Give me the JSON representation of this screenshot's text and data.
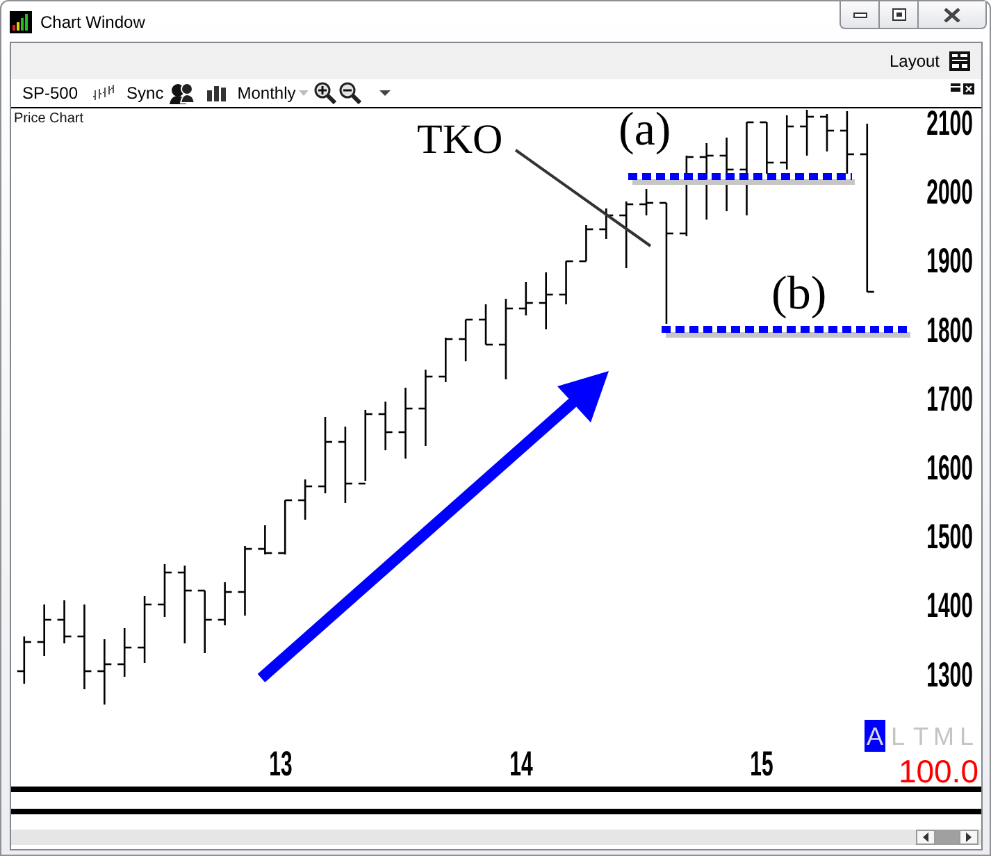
{
  "window": {
    "title": "Chart Window"
  },
  "header": {
    "layout_label": "Layout"
  },
  "toolbar": {
    "symbol": "SP-500",
    "sync_label": "Sync",
    "period": "Monthly"
  },
  "chart": {
    "title": "Price Chart",
    "y_axis_labels": [
      "2100",
      "2000",
      "1900",
      "1800",
      "1700",
      "1600",
      "1500",
      "1400",
      "1300"
    ],
    "x_axis_labels": [
      "13",
      "14",
      "15"
    ],
    "annotations": [
      {
        "kind": "callout",
        "text": "TKO"
      },
      {
        "kind": "upper_level",
        "text": "(a)"
      },
      {
        "kind": "lower_level",
        "text": "(b)"
      }
    ],
    "scale_modes": [
      {
        "label": "A",
        "selected": true
      },
      {
        "label": "L",
        "selected": false
      },
      {
        "label": "T",
        "selected": false
      },
      {
        "label": "M",
        "selected": false
      },
      {
        "label": "L",
        "selected": false
      }
    ],
    "reading": "100.0"
  }
}
